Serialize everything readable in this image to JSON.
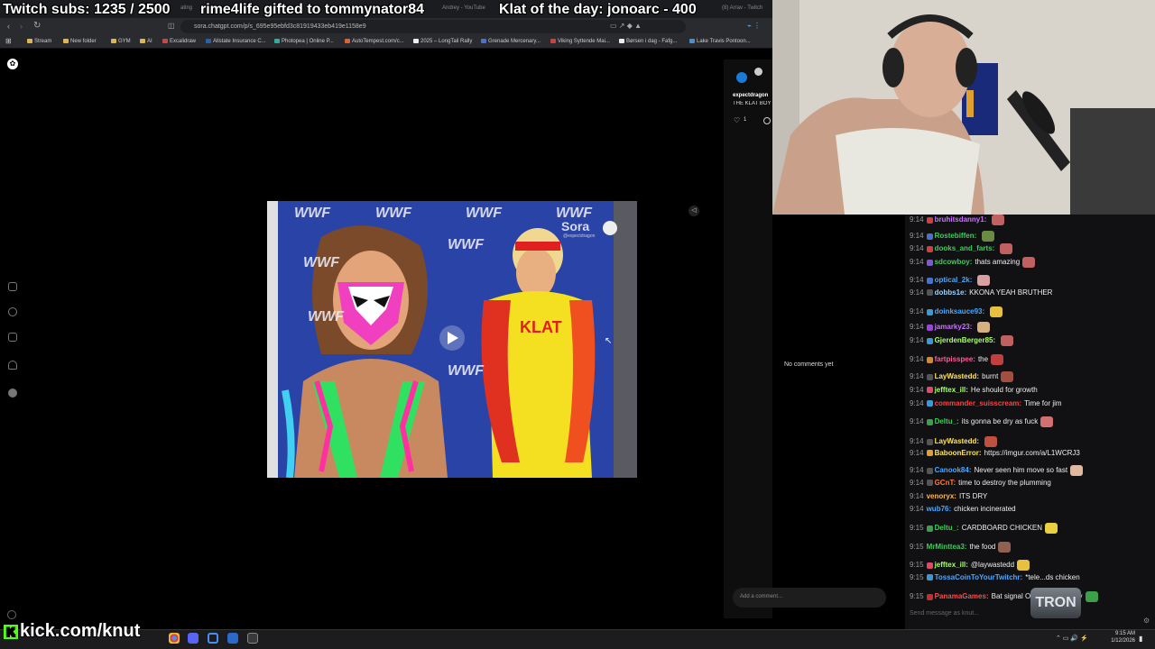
{
  "overlay": {
    "subs": "Twitch subs: 1235 / 2500",
    "gift": "rime4life gifted to tommynator84",
    "klat": "Klat of the day: jonoarc - 400"
  },
  "browser": {
    "tabs": [
      "ating",
      "Andrey - YouTube",
      "(8) Arrav - Twitch"
    ],
    "url": "sora.chatgpt.com/p/s_695e95ebfd3c81919433eb419e1158e9",
    "bookmarks": [
      "Stream",
      "New folder",
      "GYM",
      "AI",
      "Excalidraw",
      "Allstate Insurance C...",
      "Photopea | Online P...",
      "AutoTempest.com/c...",
      "2025 – LongTail Rally",
      "Grenade Mercenary...",
      "Viking Syttende Mai...",
      "Børsen i dag - Fafg...",
      "Lake Travis Pontoon..."
    ]
  },
  "sora": {
    "watermark": "Sora",
    "watermark_user": "@expectdragon",
    "video_text": "KLAT",
    "wwf_logo": "WWF",
    "author": "expectdragon",
    "caption": "THE KLAT BOY",
    "likes": "1",
    "no_comments": "No comments yet",
    "comment_placeholder": "Add a comment..."
  },
  "chat": {
    "messages": [
      {
        "time": "9:14",
        "user": "bruhitsdanny1:",
        "text": "",
        "color": "#c873ff",
        "badge": "#d04040",
        "emote": "#c06060"
      },
      {
        "time": "9:14",
        "user": "Rostebiffen:",
        "text": "",
        "color": "#3ccf5a",
        "badge": "#4a70d0",
        "emote": "#6b8a44"
      },
      {
        "time": "9:14",
        "user": "dooks_and_farts:",
        "text": "",
        "color": "#3ccf5a",
        "badge": "#d04040",
        "emote": "#c06060"
      },
      {
        "time": "9:14",
        "user": "sdcowboy:",
        "text": "thats amazing",
        "color": "#3ccf5a",
        "badge": "#7a5cc8",
        "emote": "#c06060"
      },
      {
        "time": "9:14",
        "user": "optical_2k:",
        "text": "",
        "color": "#4aa8ff",
        "badge": "#4a70d0",
        "emote": "#d8a0a0"
      },
      {
        "time": "9:14",
        "user": "dobbs1e:",
        "text": "KKONA YEAH BRUTHER",
        "color": "#9ad0ff",
        "badge": "#555",
        "emote": ""
      },
      {
        "time": "9:14",
        "user": "doinksauce93:",
        "text": "",
        "color": "#4aa8ff",
        "badge": "#3a9ad8",
        "emote": "#e8c040"
      },
      {
        "time": "9:14",
        "user": "jamarky23:",
        "text": "",
        "color": "#c873ff",
        "badge": "#9a46d8",
        "emote": "#d8b080"
      },
      {
        "time": "9:14",
        "user": "GjerdenBerger85:",
        "text": "",
        "color": "#a8ff6a",
        "badge": "#3a9ad8",
        "emote": "#c06060"
      },
      {
        "time": "9:14",
        "user": "fartpisspee:",
        "text": "the",
        "color": "#ff5a9a",
        "badge": "#cc8a3a",
        "emote": "#c04040"
      },
      {
        "time": "9:14",
        "user": "LayWastedd:",
        "text": "burnt",
        "color": "#ffe45a",
        "badge": "#555",
        "emote": "#a05040"
      },
      {
        "time": "9:14",
        "user": "jefftex_ill:",
        "text": "He should for growth",
        "color": "#a8ff6a",
        "badge": "#e04a6a",
        "emote": ""
      },
      {
        "time": "9:14",
        "user": "commander_suisscream:",
        "text": "Time for jim",
        "color": "#ff4040",
        "badge": "#3a9ad8",
        "emote": ""
      },
      {
        "time": "9:14",
        "user": "Deltu_:",
        "text": "its gonna be dry as fuck",
        "color": "#3ccf5a",
        "badge": "#3ca04a",
        "emote": "#d07070"
      },
      {
        "time": "9:14",
        "user": "LayWastedd:",
        "text": "",
        "color": "#ffe45a",
        "badge": "#555",
        "emote": "#c05040"
      },
      {
        "time": "9:14",
        "user": "BaboonError:",
        "text": "https://imgur.com/a/L1WCRJ3",
        "color": "#ffe45a",
        "badge": "#e0a030",
        "emote": ""
      },
      {
        "time": "9:14",
        "user": "Canook84:",
        "text": "Never seen him move so fast",
        "color": "#4aa8ff",
        "badge": "#555",
        "emote": "#e0b8a0"
      },
      {
        "time": "9:14",
        "user": "GCnT:",
        "text": "time to destroy the plumming",
        "color": "#ff7a3a",
        "badge": "#555",
        "emote": ""
      },
      {
        "time": "9:14",
        "user": "venoryx:",
        "text": "ITS DRY",
        "color": "#ffb84a",
        "badge": "",
        "emote": ""
      },
      {
        "time": "9:14",
        "user": "wub76:",
        "text": "chicken incinerated",
        "color": "#4aa8ff",
        "badge": "",
        "emote": ""
      },
      {
        "time": "9:15",
        "user": "Deltu_:",
        "text": "CARDBOARD CHICKEN",
        "color": "#3ccf5a",
        "badge": "#3ca04a",
        "emote": "#e8d040"
      },
      {
        "time": "9:15",
        "user": "MrMinttea3:",
        "text": "the food",
        "color": "#3ccf5a",
        "badge": "",
        "emote": "#906050"
      },
      {
        "time": "9:15",
        "user": "jefftex_ill:",
        "text": "@laywastedd",
        "color": "#a8ff6a",
        "badge": "#e04a6a",
        "emote": "#e8c040"
      },
      {
        "time": "9:15",
        "user": "TossaCoinToYourTwitchr:",
        "text": "*tele...ds chicken",
        "color": "#4aa8ff",
        "badge": "#3a9ad8",
        "emote": ""
      },
      {
        "time": "9:15",
        "user": "PanamaGames:",
        "text": "Bat signal O... KAIS is ready",
        "color": "#ff4a4a",
        "badge": "#c03030",
        "emote": "#3ca04a"
      }
    ],
    "input_placeholder": "Send message as knut..."
  },
  "stream": {
    "kick_url": "kick.com/knut",
    "tron_logo": "TRON",
    "clock_time": "9:15 AM",
    "clock_date": "1/12/2026"
  },
  "colors": {
    "kick": "#53fc18",
    "chat_bg": "#111113"
  }
}
